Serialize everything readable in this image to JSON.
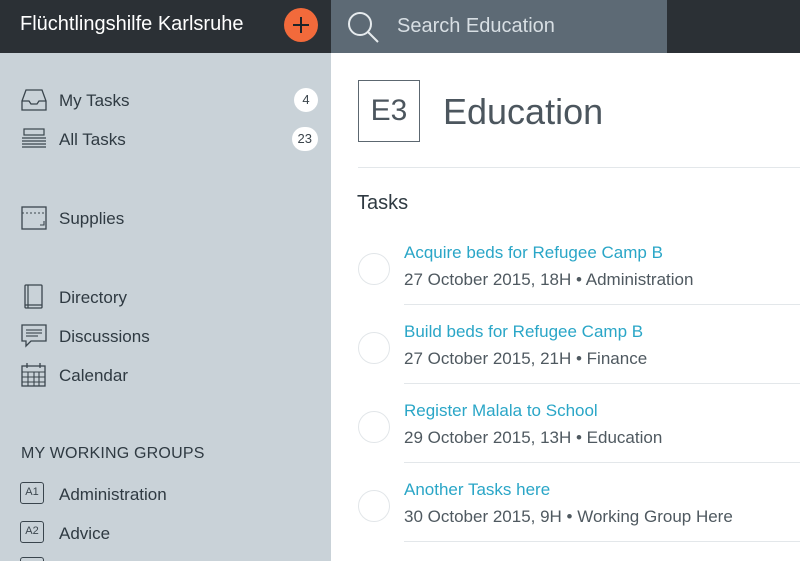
{
  "topbar": {
    "org_name": "Flüchtlingshilfe Karlsruhe",
    "search_placeholder": "Search Education",
    "accent_color": "#f26a3b"
  },
  "sidebar": {
    "items": [
      {
        "label": "My Tasks",
        "icon": "inbox-icon",
        "count": "4"
      },
      {
        "label": "All Tasks",
        "icon": "stack-icon",
        "count": "23"
      },
      {
        "label": "Supplies",
        "icon": "box-icon"
      },
      {
        "label": "Directory",
        "icon": "book-icon"
      },
      {
        "label": "Discussions",
        "icon": "chat-icon"
      },
      {
        "label": "Calendar",
        "icon": "calendar-icon"
      }
    ],
    "groups_heading": "MY WORKING GROUPS",
    "groups": [
      {
        "tag": "A1",
        "label": "Administration"
      },
      {
        "tag": "A2",
        "label": "Advice"
      }
    ]
  },
  "main": {
    "badge": "E3",
    "title": "Education",
    "tasks_heading": "Tasks",
    "tasks": [
      {
        "title": "Acquire beds for Refugee Camp B",
        "meta": "27 October 2015, 18H • Administration"
      },
      {
        "title": "Build beds for Refugee Camp B",
        "meta": "27 October 2015, 21H • Finance"
      },
      {
        "title": "Register Malala to School",
        "meta": "29 October 2015, 13H • Education"
      },
      {
        "title": "Another Tasks here",
        "meta": "30 October 2015, 9H • Working Group Here"
      }
    ]
  }
}
